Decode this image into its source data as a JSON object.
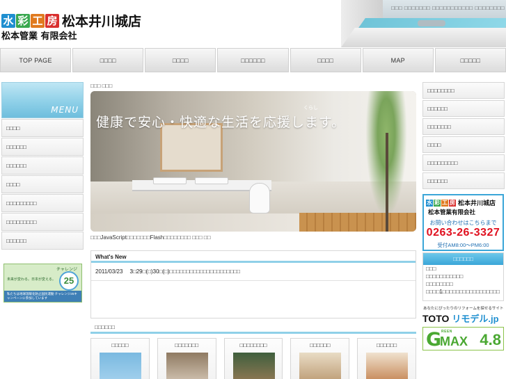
{
  "header": {
    "logo_tiles": [
      {
        "char": "水",
        "color": "#1f8fd0"
      },
      {
        "char": "彩",
        "color": "#3aa84f"
      },
      {
        "char": "工",
        "color": "#e07a1f"
      },
      {
        "char": "房",
        "color": "#d9302f"
      }
    ],
    "shop_name": "松本井川城店",
    "company": "松本管業 有限会社",
    "top_links": "□□□ □□□□□□□ □□□□□□□□□□□ □□□□□□□□"
  },
  "nav": [
    {
      "label": "TOP PAGE"
    },
    {
      "label": "□□□□"
    },
    {
      "label": "□□□□"
    },
    {
      "label": "□□□□□□"
    },
    {
      "label": "□□□□"
    },
    {
      "label": "MAP"
    },
    {
      "label": "□□□□□"
    }
  ],
  "left_menu": {
    "title": "MENU",
    "items": [
      "□□□□",
      "□□□□□□",
      "□□□□□□",
      "□□□□",
      "□□□□□□□□□",
      "□□□□□□□□□",
      "□□□□□□"
    ]
  },
  "banner": {
    "brand": "チャレンジ",
    "number": "25",
    "tagline": "未来が変わる。日本が変える。",
    "bottom": "私たちは地球温暖化防止国民運動 チャレンジ25キャンペーンに参加しています"
  },
  "breadcrumb": "□□□ □□□",
  "hero": {
    "text": "健康で安心・快適な生活を応援します。",
    "ruby": "くらし"
  },
  "flash_note": "□□□JavaScript□□□□□□□Flash□□□□□□□□ □□□ □□",
  "news": {
    "title": "What's New",
    "items": [
      {
        "date": "2011/03/23",
        "text": "3□29□(□)30□(□)□□□□□□□□□□□□□□□□□□□□□"
      }
    ]
  },
  "menu2": {
    "title": "□□□□□□",
    "cards": [
      {
        "label": "□□□□□",
        "thumb": "#8bc6e8"
      },
      {
        "label": "□□□□□□□",
        "thumb": "#b79a7a"
      },
      {
        "label": "□□□□□□□□",
        "thumb": "#5b7f5a"
      },
      {
        "label": "□□□□□□",
        "thumb": "#c9b08e"
      },
      {
        "label": "□□□□□□",
        "thumb": "#c98a5a"
      }
    ]
  },
  "right_menu": {
    "items": [
      "□□□□□□□□",
      "□□□□□□",
      "□□□□□□□",
      "□□□□",
      "□□□□□□□□□",
      "□□□□□□"
    ]
  },
  "shop_card": {
    "tiles": [
      {
        "char": "水",
        "color": "#1f8fd0"
      },
      {
        "char": "彩",
        "color": "#3aa84f"
      },
      {
        "char": "工",
        "color": "#e07a1f"
      },
      {
        "char": "房",
        "color": "#d9302f"
      }
    ],
    "shop_name": "松本井川城店",
    "company": "松本管業有限会社",
    "ask": "お問い合わせはこちらまで",
    "tel": "0263-26-3327",
    "hours": "受付AM8:00〜PM6:00"
  },
  "info_box": {
    "title": "□□□□□□",
    "lines": [
      "□□□",
      "□□□□□□□□□□□",
      "□□□□□□□□",
      "□□□□1□□□□□□□□□□□□□□□□□"
    ]
  },
  "remodel": {
    "caption": "あなたにぴったりのリフォームを探せるサイト",
    "toto": "TOTO",
    "site": "リモデル.jp"
  },
  "gmax": {
    "g": "G",
    "green": "REEN",
    "max": "MAX",
    "version": "4.8"
  }
}
